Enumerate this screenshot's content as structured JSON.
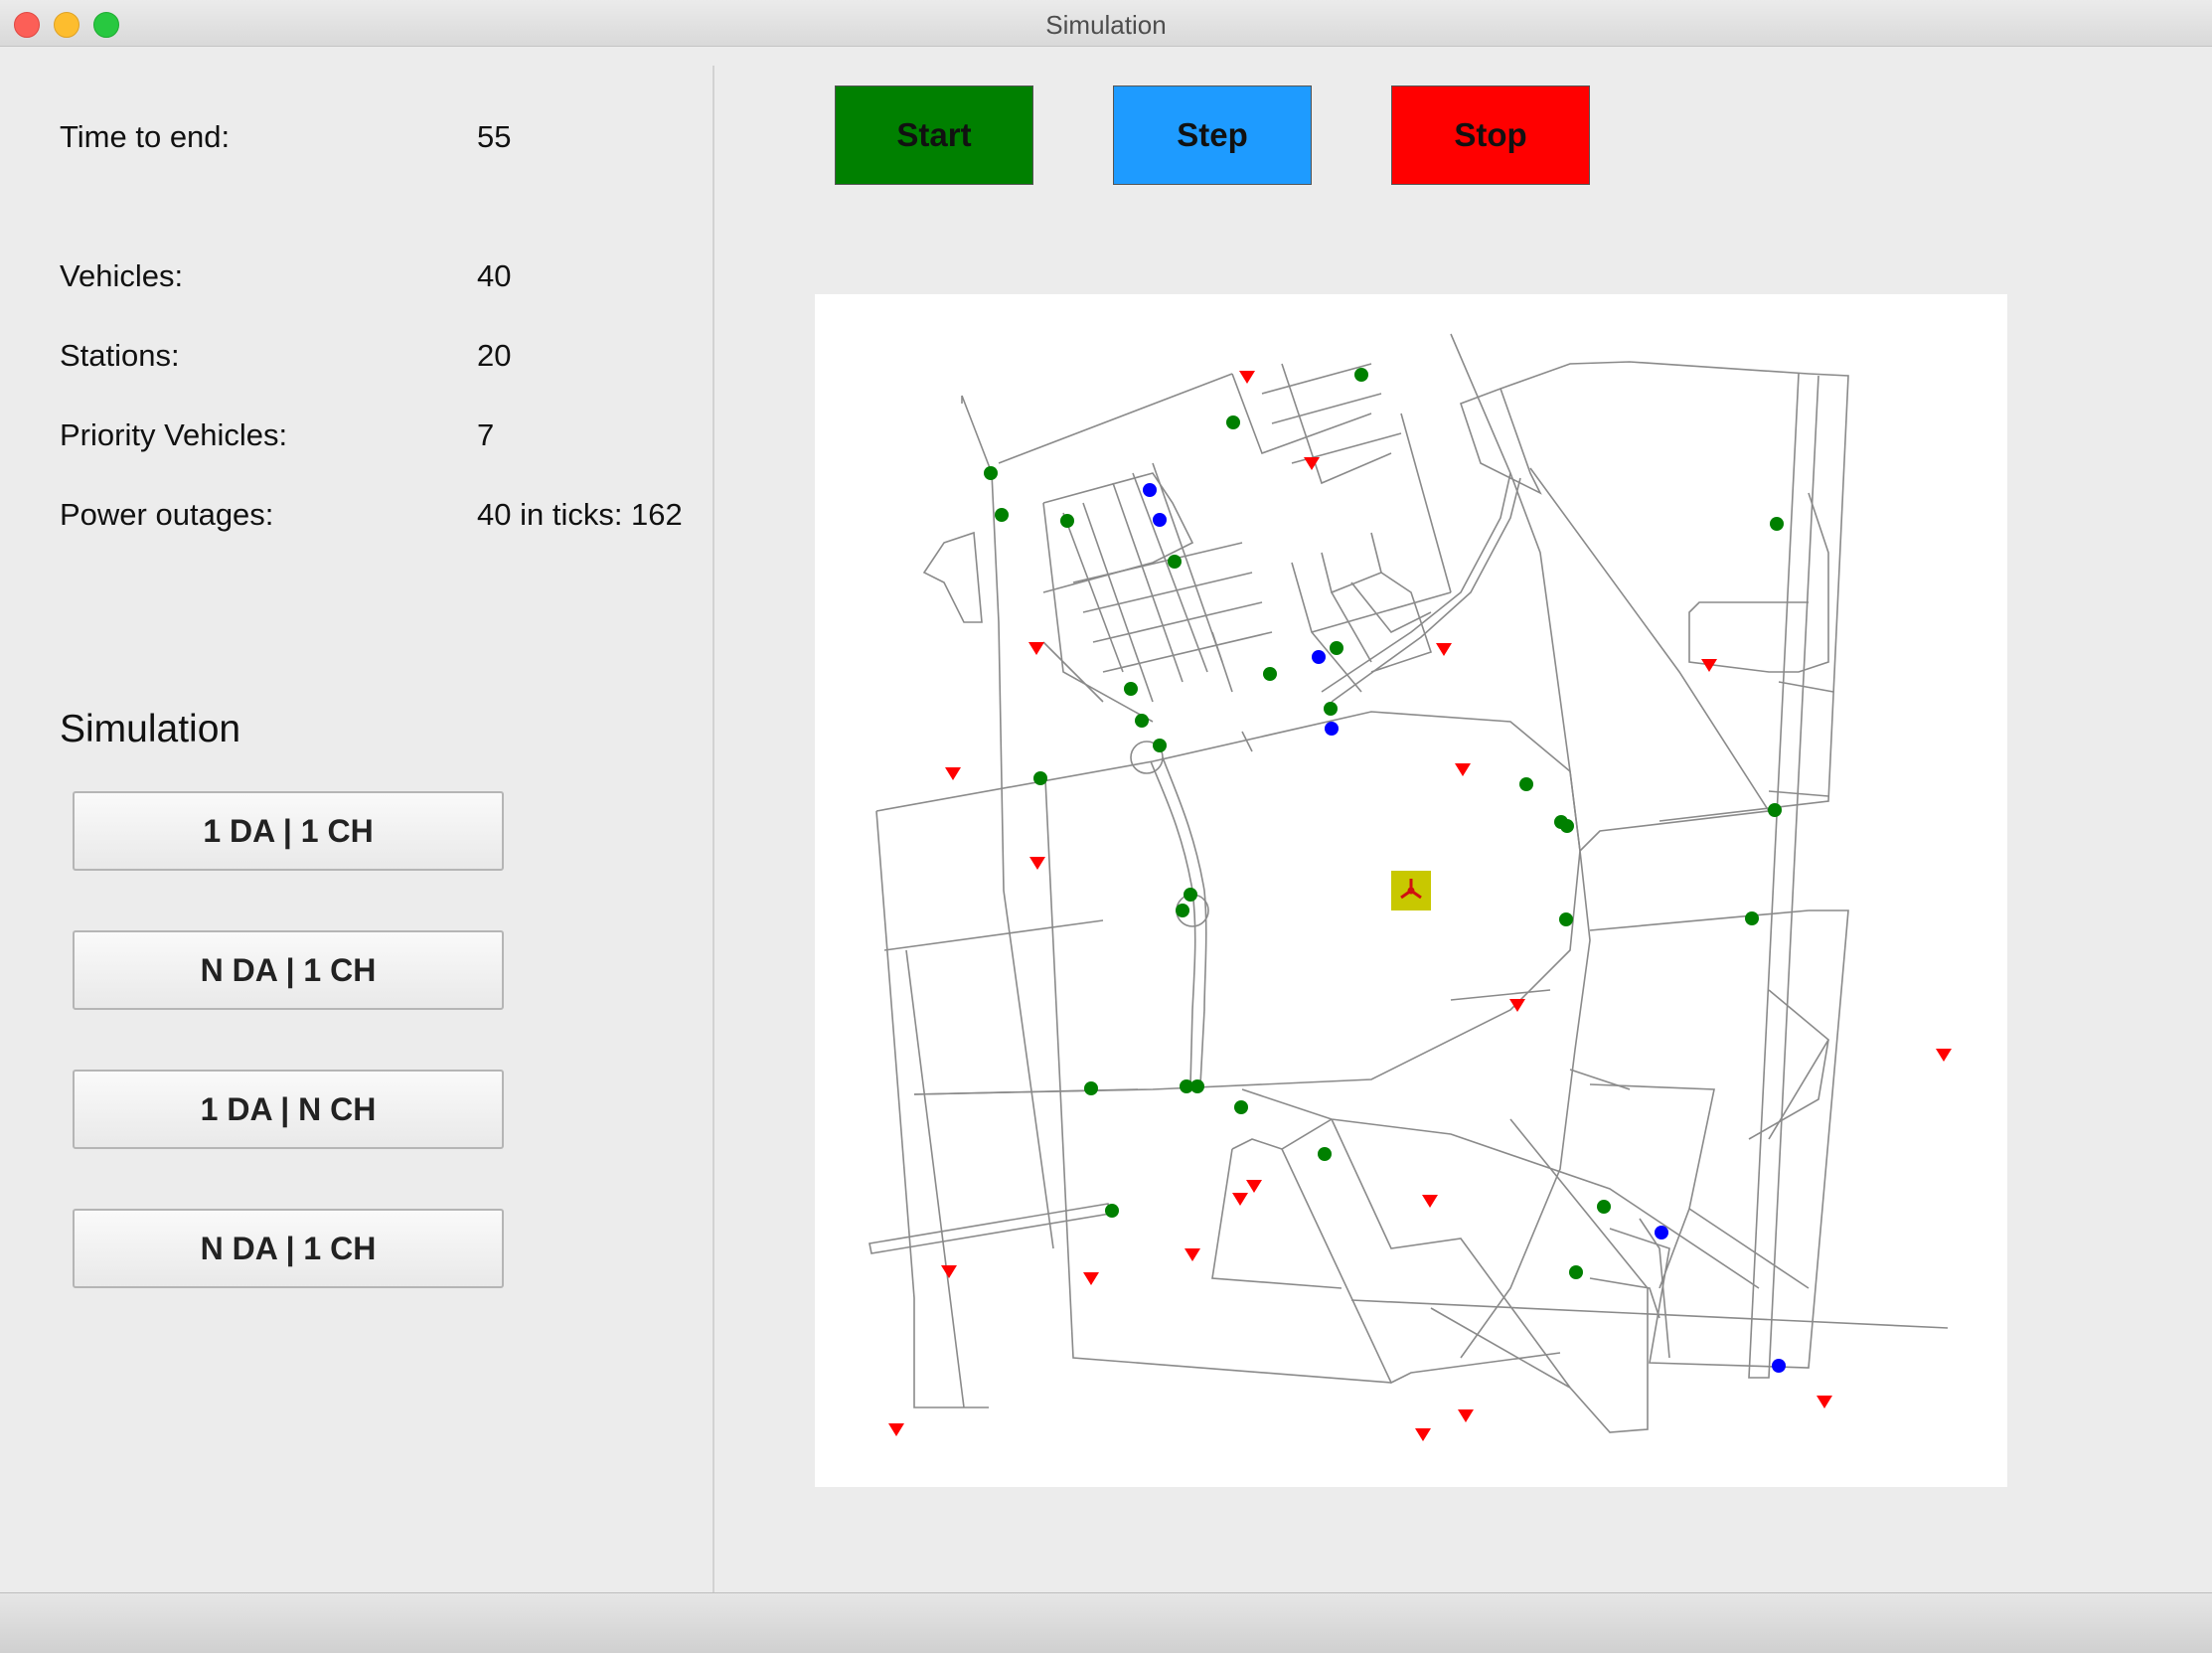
{
  "window": {
    "title": "Simulation"
  },
  "info": {
    "time_to_end": {
      "label": "Time to end:",
      "value": "55"
    },
    "vehicles": {
      "label": "Vehicles:",
      "value": "40"
    },
    "stations": {
      "label": "Stations:",
      "value": "20"
    },
    "priority_vehicles": {
      "label": "Priority Vehicles:",
      "value": "7"
    },
    "power_outages": {
      "label": "Power outages:",
      "value": "40 in ticks: 162"
    }
  },
  "simulation": {
    "title": "Simulation",
    "buttons": [
      "1 DA | 1 CH",
      "N DA | 1 CH",
      "1 DA | N CH",
      "N DA | 1 CH"
    ]
  },
  "controls": {
    "start": {
      "label": "Start",
      "color": "#008000"
    },
    "step": {
      "label": "Step",
      "color": "#1e9bff"
    },
    "stop": {
      "label": "Stop",
      "color": "#ff0000"
    }
  },
  "map": {
    "vehicle_color": "#008000",
    "priority_vehicle_color": "#0000ff",
    "station_color": "#ff0000",
    "road_color": "#8a8a8a",
    "center_marker_color": "#c8c800",
    "center_icon": "radiation-icon"
  }
}
